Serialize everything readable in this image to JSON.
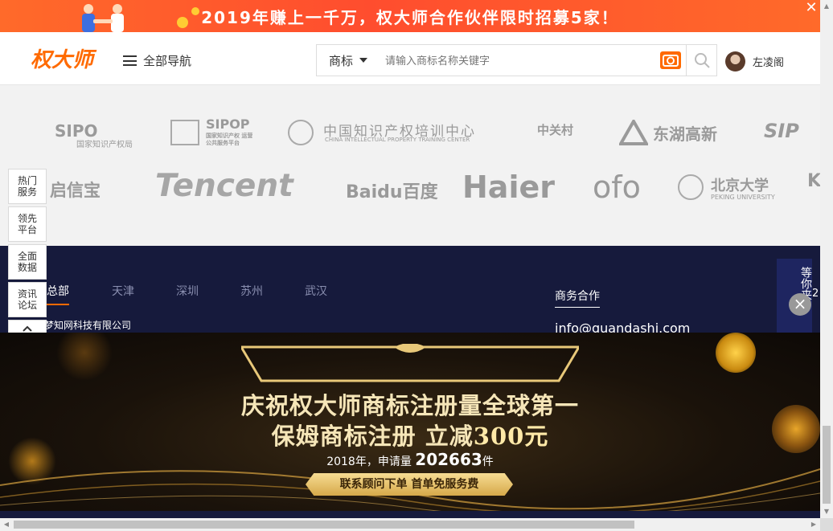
{
  "promo": {
    "text": "2019年赚上一千万，权大师合作伙伴限时招募5家！",
    "close": "✕"
  },
  "header": {
    "logo": "权大师",
    "nav_all": "全部导航",
    "search": {
      "category": "商标",
      "placeholder": "请输入商标名称关键字"
    },
    "user_name": "左凌阁"
  },
  "partners": {
    "row1": [
      "SIPO",
      "国家知识产权局",
      "SIPOP",
      "国家知识产权 运营公共服务平台",
      "中国知识产权培训中心",
      "CHINA INTELLECTUAL PROPERTY TRAINING CENTER",
      "中关村",
      "东湖高新",
      "SIP"
    ],
    "row2": [
      "启信宝",
      "Tencent",
      "Baidu百度",
      "Haier",
      "ofo",
      "北京大学",
      "PEKING UNIVERSITY",
      "K"
    ]
  },
  "side_menu": [
    {
      "label": "热门 服务"
    },
    {
      "label": "领先 平台"
    },
    {
      "label": "全面 数据"
    },
    {
      "label": "资讯 论坛"
    }
  ],
  "footer": {
    "cities": [
      "总部",
      "天津",
      "深圳",
      "苏州",
      "武汉"
    ],
    "company": "梦知网科技有限公司",
    "biz_title": "商务合作",
    "biz_mail": "info@quandashi.com",
    "wait_text": "等你来！",
    "wait_num": "2"
  },
  "big_promo": {
    "title": "庆祝权大师商标注册量全球第一",
    "sub_prefix": "保姆商标注册 立减",
    "sub_amount": "300元",
    "stat_prefix": "2018年，申请量",
    "stat_value": "202663",
    "stat_unit": "件",
    "button": "联系顾问下单 首单免服务费"
  },
  "colors": {
    "brand": "#ff6a00",
    "footer_bg": "#161a3c",
    "gold": "#f6e6b8"
  }
}
